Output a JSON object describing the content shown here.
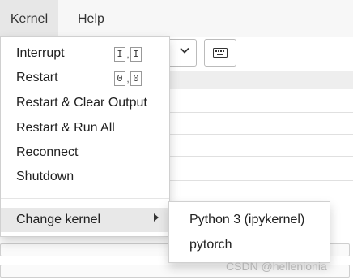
{
  "menubar": {
    "items": [
      {
        "label": "Kernel"
      },
      {
        "label": "Help"
      }
    ]
  },
  "kernel_menu": {
    "items": [
      {
        "label": "Interrupt",
        "shortcut": [
          "I",
          "I"
        ]
      },
      {
        "label": "Restart",
        "shortcut": [
          "0",
          "0"
        ]
      },
      {
        "label": "Restart & Clear Output"
      },
      {
        "label": "Restart & Run All"
      },
      {
        "label": "Reconnect"
      },
      {
        "label": "Shutdown"
      },
      {
        "label": "Change kernel",
        "has_submenu": true
      }
    ],
    "shortcut_separator": ","
  },
  "change_kernel_submenu": {
    "items": [
      {
        "label": "Python 3 (ipykernel)"
      },
      {
        "label": "pytorch"
      }
    ]
  },
  "watermark": "CSDN @hellenionia",
  "icons": {
    "submenu_arrow": "caret-right-icon",
    "dropdown": "chevron-down-icon",
    "keyboard": "keyboard-icon"
  }
}
